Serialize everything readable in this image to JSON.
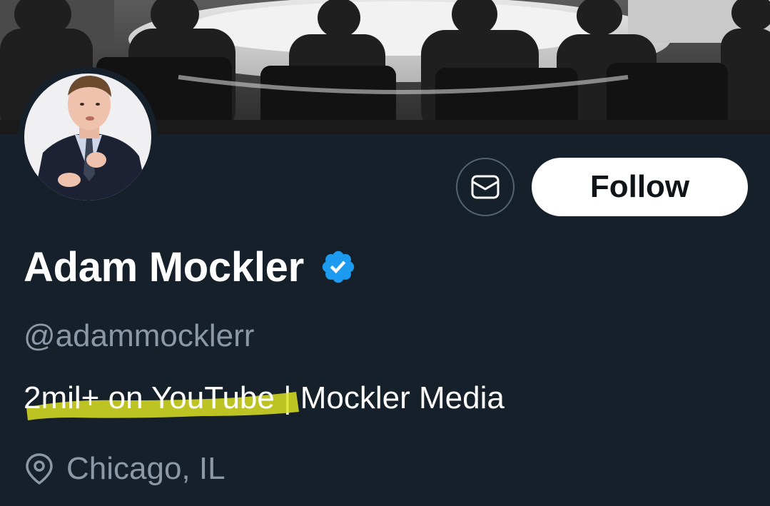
{
  "profile": {
    "display_name": "Adam Mockler",
    "verified": true,
    "handle": "@adammocklerr",
    "bio_highlighted": "2mil+ on YouTube",
    "bio_rest": " | Mockler Media",
    "location": "Chicago, IL"
  },
  "actions": {
    "follow_label": "Follow",
    "message_icon": "envelope-icon"
  },
  "colors": {
    "background": "#15202b",
    "verified_badge": "#1d9bf0",
    "secondary_text": "#8b98a5",
    "highlight": "#d9e021"
  }
}
